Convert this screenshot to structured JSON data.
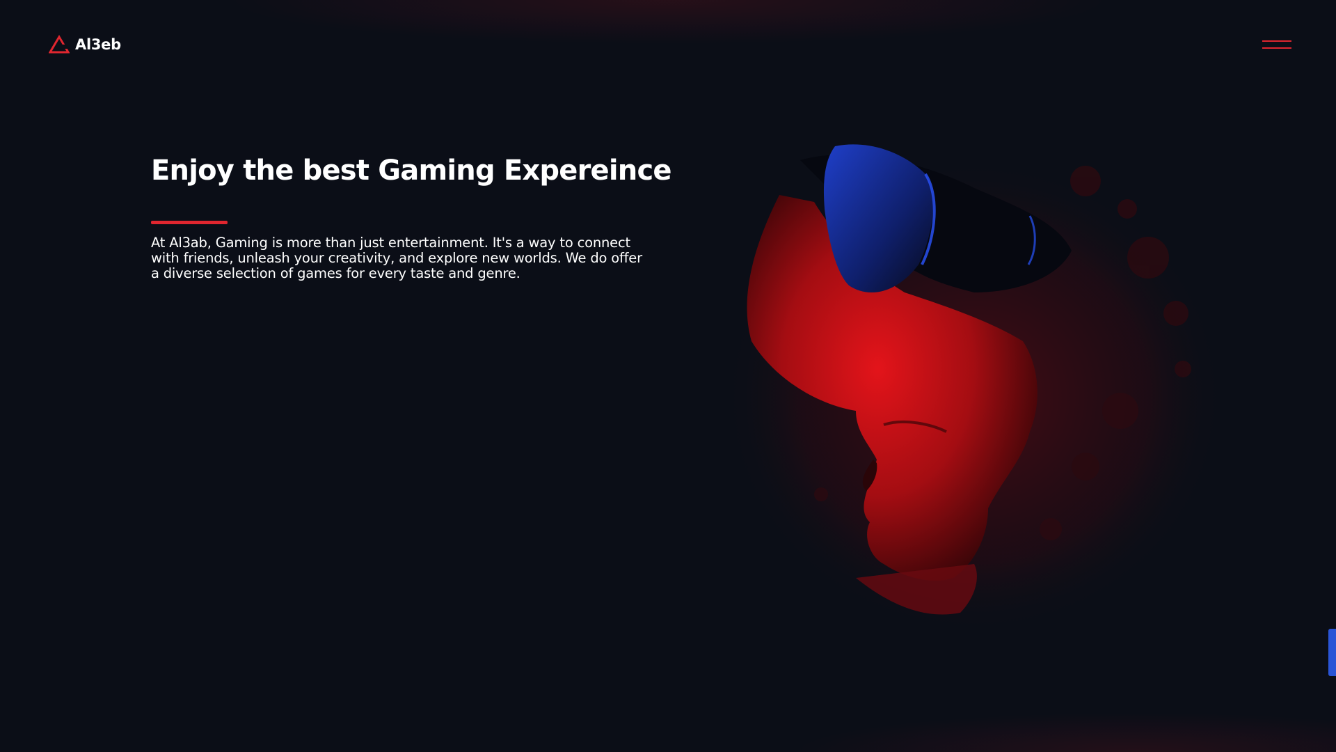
{
  "header": {
    "brand": "Al3eb",
    "logo_icon": "triangle-logo-icon",
    "menu_icon": "hamburger-menu-icon"
  },
  "hero": {
    "title": "Enjoy the best Gaming Expereince",
    "description": "At Al3ab, Gaming is more than just entertainment. It's a way to connect with friends, unleash your creativity, and explore new worlds. We do offer a diverse selection of games for every taste and genre.",
    "image": "vr-headset-face-illustration"
  },
  "colors": {
    "background": "#0b0e17",
    "accent": "#e0262f",
    "side_tab": "#2a55d6",
    "text": "#ffffff"
  }
}
